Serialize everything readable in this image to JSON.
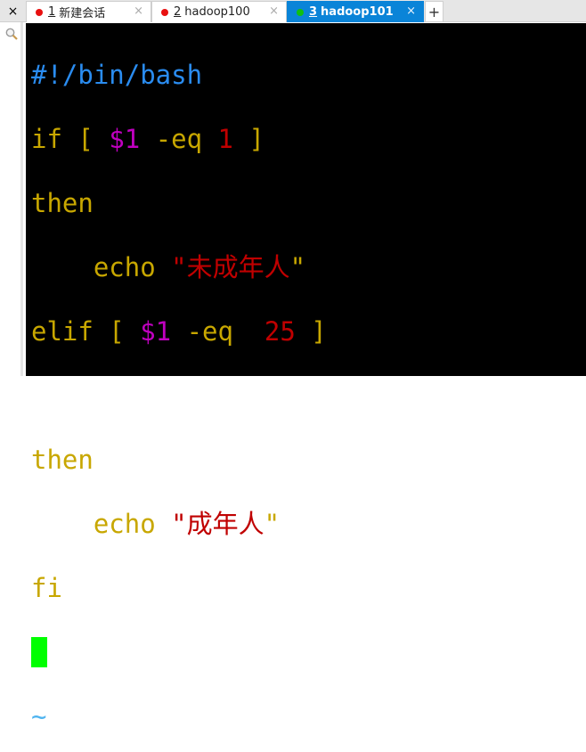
{
  "tabs": [
    {
      "number": "1",
      "label": "新建会话",
      "status_color": "#e81010",
      "active": false
    },
    {
      "number": "2",
      "label": "hadoop100",
      "status_color": "#e81010",
      "active": false
    },
    {
      "number": "3",
      "label": "hadoop101",
      "status_color": "#10c010",
      "active": true
    }
  ],
  "tab_close": "×",
  "new_tab": "+",
  "side_close": "×",
  "terminal": {
    "shebang": "#!/bin/bash",
    "l2": {
      "kw": "if [ ",
      "var": "$1",
      "op": " -eq ",
      "num": "1",
      "end": " ]"
    },
    "l3": "then",
    "l4": {
      "cmd": "    echo ",
      "q1": "\"",
      "str": "未成年人",
      "q2": "\""
    },
    "l5": {
      "kw": "elif [ ",
      "var": "$1",
      "op": " -eq  ",
      "num": "25",
      "end": " ]"
    },
    "l7": "then",
    "l8": {
      "cmd": "    echo ",
      "q1": "\"",
      "str": "成年人",
      "q2": "\""
    },
    "l9": "fi",
    "tilde": "~"
  }
}
